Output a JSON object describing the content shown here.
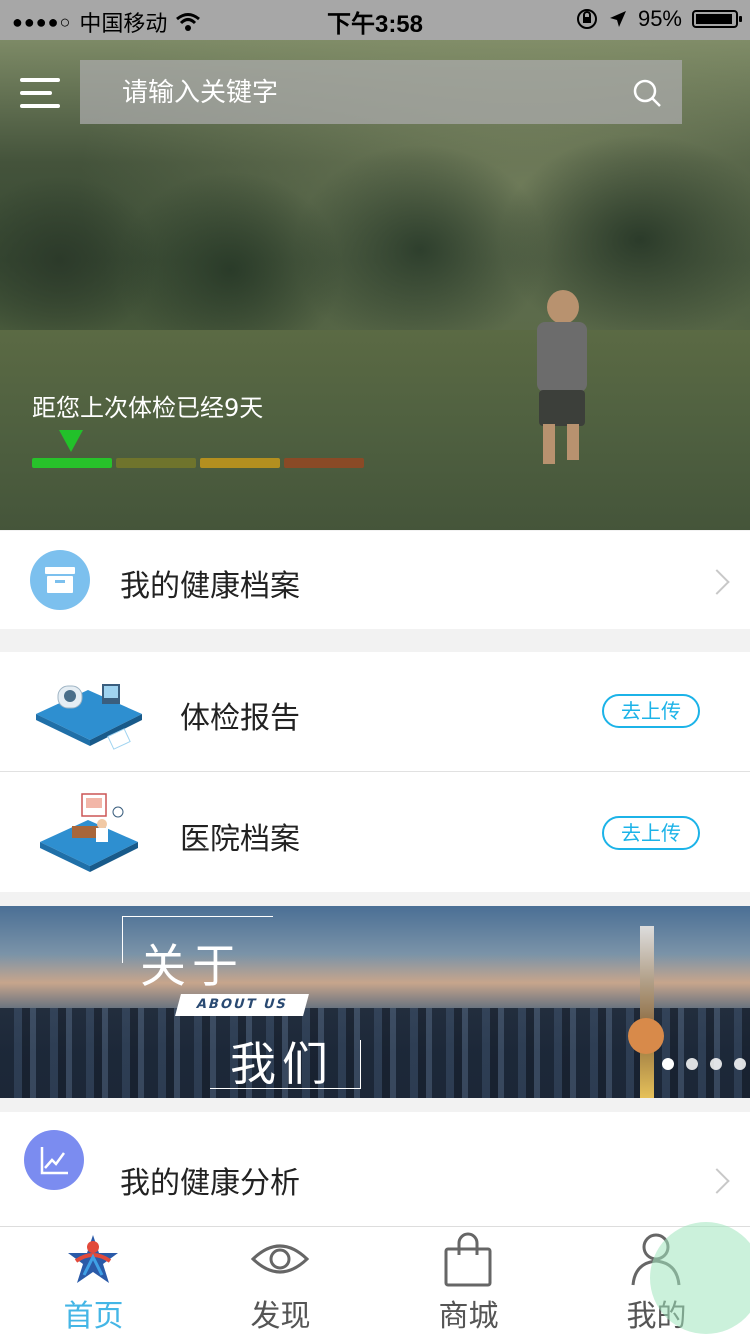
{
  "status_bar": {
    "signal": "●●●●○",
    "carrier": "中国移动",
    "time": "下午3:58",
    "battery_pct": "95%",
    "battery_level": 0.95,
    "icons": [
      "wifi-icon",
      "rotation-lock-icon",
      "location-arrow-icon",
      "battery-icon"
    ]
  },
  "header": {
    "menu_icon": "hamburger-menu-icon",
    "search_placeholder": "请输入关键字",
    "search_icon": "search-icon"
  },
  "hero": {
    "checkup_text": "距您上次体检已经9天",
    "progress_colors": [
      "#27c22a",
      "#6f742c",
      "#b38f1f",
      "#8a4a26"
    ],
    "progress_active_index": 0
  },
  "health_record": {
    "label": "我的健康档案",
    "icon": "archive-box-icon"
  },
  "reports": [
    {
      "label": "体检报告",
      "button": "去上传",
      "icon": "medical-scanner-illustration"
    },
    {
      "label": "医院档案",
      "button": "去上传",
      "icon": "doctor-office-illustration"
    }
  ],
  "banner": {
    "line1": "关于",
    "tag": "ABOUT US",
    "line2": "我们",
    "slides": 4,
    "active_slide": 0
  },
  "health_analysis": {
    "label": "我的健康分析",
    "icon": "line-chart-icon"
  },
  "tabbar": {
    "active_color": "#44b6e6",
    "items": [
      {
        "label": "首页",
        "icon": "home-logo-icon",
        "active": true
      },
      {
        "label": "发现",
        "icon": "eye-icon",
        "active": false
      },
      {
        "label": "商城",
        "icon": "shopping-bag-icon",
        "active": false
      },
      {
        "label": "我的",
        "icon": "user-icon",
        "active": false
      }
    ]
  }
}
